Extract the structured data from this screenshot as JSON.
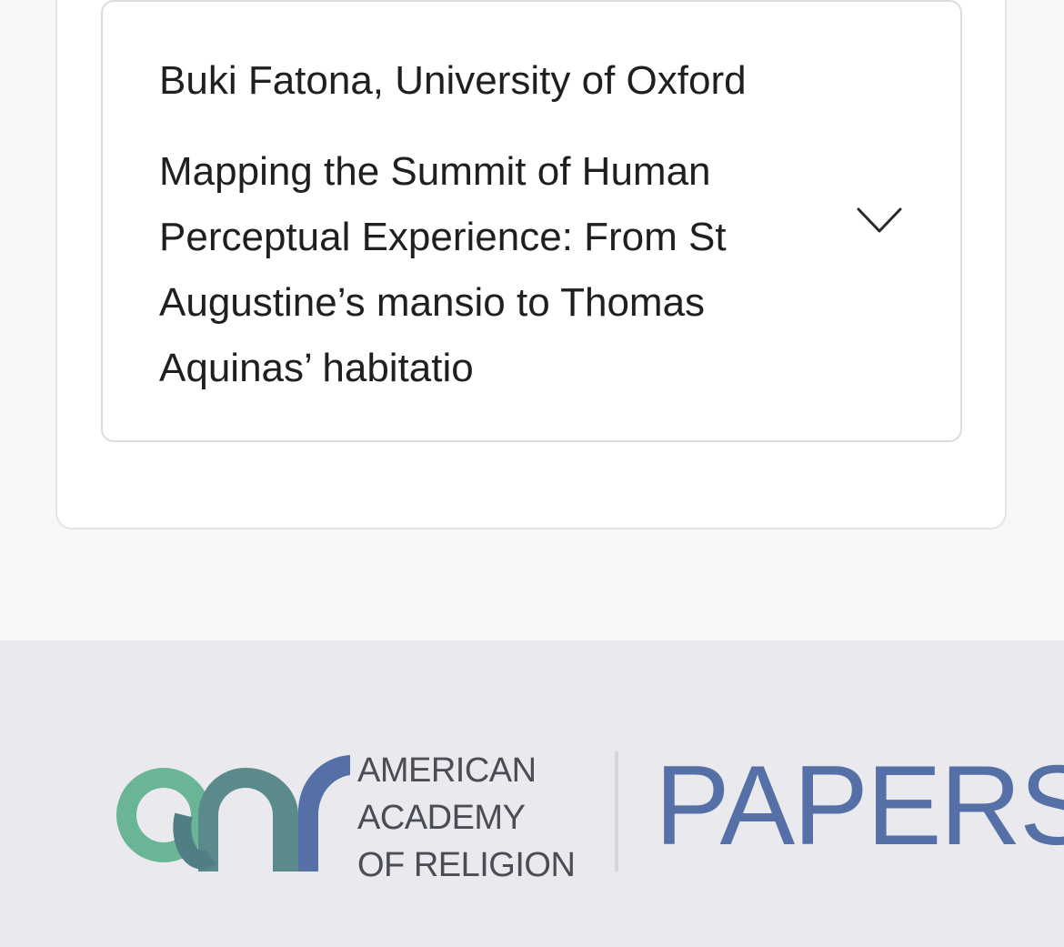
{
  "paper_card": {
    "author": "Buki Fatona, University of Oxford",
    "title": "Mapping the Summit of Human Perceptual Experience: From St Augustine’s mansio to Thomas Aquinas’ habitatio",
    "expand_icon": "chevron-down-icon"
  },
  "footer": {
    "logo_icon": "aar-logo-icon",
    "org_line_1": "AMERICAN",
    "org_line_2": "ACADEMY",
    "org_line_3": "OF  RELIGION",
    "brand_word": "PAPERS",
    "colors": {
      "logo_green": "#6ab596",
      "logo_teal": "#5a8a8c",
      "logo_blue": "#5570a7",
      "brand": "#5570a7"
    }
  }
}
